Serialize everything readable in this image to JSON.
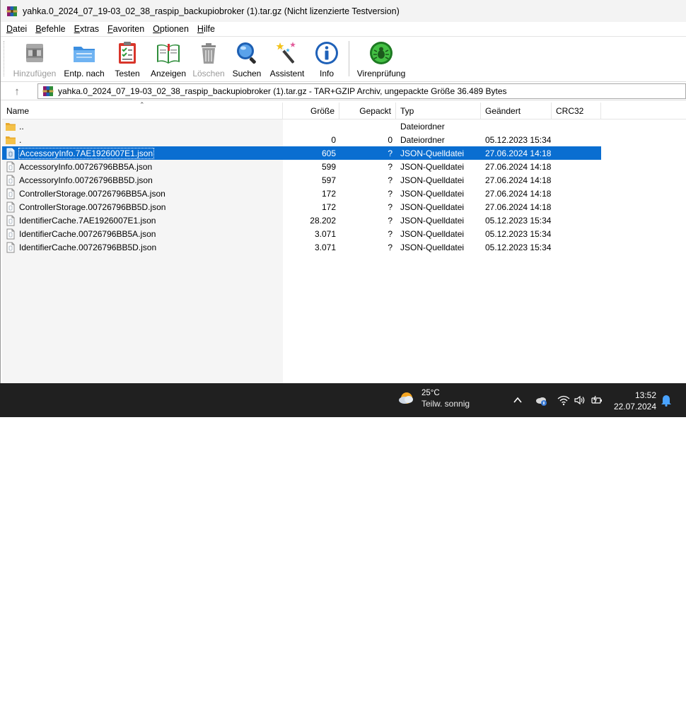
{
  "window": {
    "title": "yahka.0_2024_07_19-03_02_38_raspip_backupiobroker (1).tar.gz (Nicht lizenzierte Testversion)"
  },
  "menu": [
    {
      "label": "Datei",
      "key": "D",
      "rest": "atei"
    },
    {
      "label": "Befehle",
      "key": "B",
      "rest": "efehle"
    },
    {
      "label": "Extras",
      "key": "E",
      "rest": "xtras"
    },
    {
      "label": "Favoriten",
      "key": "F",
      "rest": "avoriten"
    },
    {
      "label": "Optionen",
      "key": "O",
      "rest": "ptionen"
    },
    {
      "label": "Hilfe",
      "key": "H",
      "rest": "ilfe"
    }
  ],
  "toolbar": {
    "add": "Hinzufügen",
    "extract": "Entp. nach",
    "test": "Testen",
    "view": "Anzeigen",
    "delete": "Löschen",
    "find": "Suchen",
    "wizard": "Assistent",
    "info": "Info",
    "virus": "Virenprüfung"
  },
  "address": {
    "text": "yahka.0_2024_07_19-03_02_38_raspip_backupiobroker (1).tar.gz - TAR+GZIP Archiv, ungepackte Größe 36.489 Bytes"
  },
  "columns": {
    "name": "Name",
    "size": "Größe",
    "packed": "Gepackt",
    "type": "Typ",
    "modified": "Geändert",
    "crc": "CRC32"
  },
  "rows": [
    {
      "icon": "folder-icon",
      "name": "..",
      "size": "",
      "packed": "",
      "type": "Dateiordner",
      "modified": ""
    },
    {
      "icon": "folder-icon",
      "name": ".",
      "size": "0",
      "packed": "0",
      "type": "Dateiordner",
      "modified": "05.12.2023 15:34"
    },
    {
      "icon": "file-icon",
      "name": "AccessoryInfo.7AE1926007E1.json",
      "size": "605",
      "packed": "?",
      "type": "JSON-Quelldatei",
      "modified": "27.06.2024 14:18",
      "selected": true
    },
    {
      "icon": "file-icon",
      "name": "AccessoryInfo.00726796BB5A.json",
      "size": "599",
      "packed": "?",
      "type": "JSON-Quelldatei",
      "modified": "27.06.2024 14:18"
    },
    {
      "icon": "file-icon",
      "name": "AccessoryInfo.00726796BB5D.json",
      "size": "597",
      "packed": "?",
      "type": "JSON-Quelldatei",
      "modified": "27.06.2024 14:18"
    },
    {
      "icon": "file-icon",
      "name": "ControllerStorage.00726796BB5A.json",
      "size": "172",
      "packed": "?",
      "type": "JSON-Quelldatei",
      "modified": "27.06.2024 14:18"
    },
    {
      "icon": "file-icon",
      "name": "ControllerStorage.00726796BB5D.json",
      "size": "172",
      "packed": "?",
      "type": "JSON-Quelldatei",
      "modified": "27.06.2024 14:18"
    },
    {
      "icon": "file-icon",
      "name": "IdentifierCache.7AE1926007E1.json",
      "size": "28.202",
      "packed": "?",
      "type": "JSON-Quelldatei",
      "modified": "05.12.2023 15:34"
    },
    {
      "icon": "file-icon",
      "name": "IdentifierCache.00726796BB5A.json",
      "size": "3.071",
      "packed": "?",
      "type": "JSON-Quelldatei",
      "modified": "05.12.2023 15:34"
    },
    {
      "icon": "file-icon",
      "name": "IdentifierCache.00726796BB5D.json",
      "size": "3.071",
      "packed": "?",
      "type": "JSON-Quelldatei",
      "modified": "05.12.2023 15:34"
    }
  ],
  "taskbar": {
    "weather_temp": "25°C",
    "weather_desc": "Teilw. sonnig",
    "time": "13:52",
    "date": "22.07.2024"
  },
  "colors": {
    "selection": "#0a6ed1",
    "taskbar": "#202020",
    "folder": "#f4c149"
  }
}
